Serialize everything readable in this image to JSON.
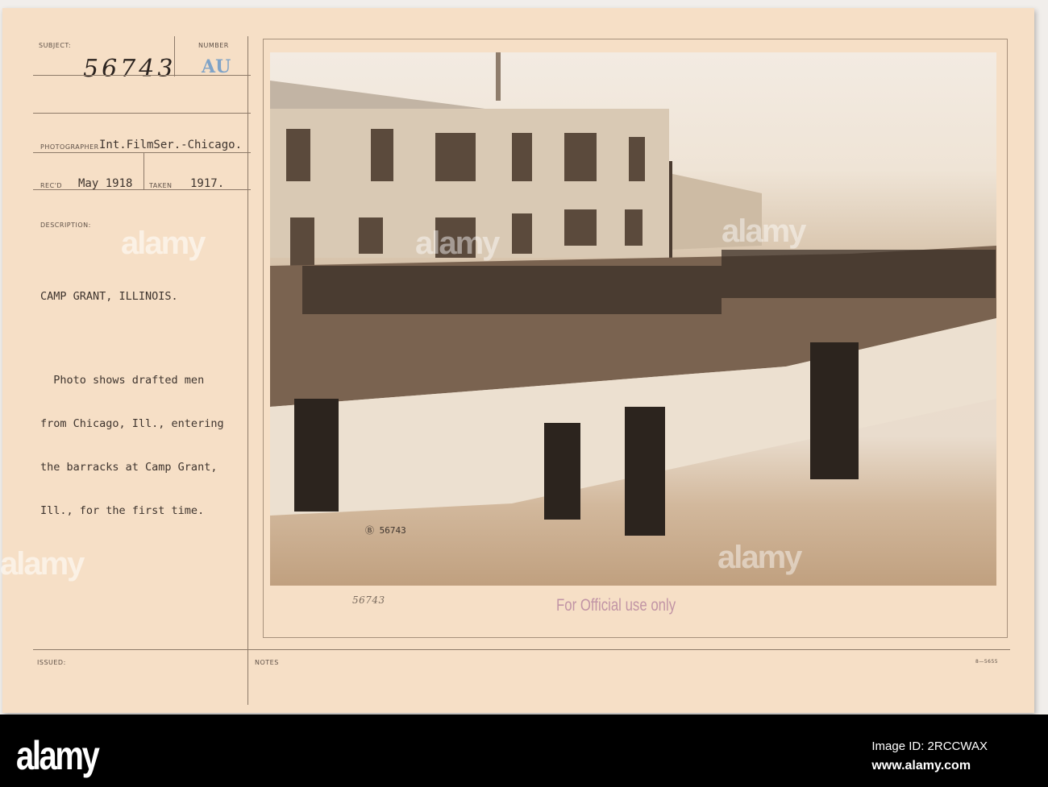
{
  "card": {
    "subject_label": "SUBJECT:",
    "subject_number": "56743",
    "number_label": "NUMBER",
    "number_value": "AU",
    "photographer_label": "PHOTOGRAPHER",
    "photographer_value": "Int.FilmSer.-Chicago.",
    "recd_label": "REC'D",
    "recd_value": "May 1918",
    "taken_label": "TAKEN",
    "taken_value": "1917.",
    "description_label": "DESCRIPTION:",
    "description_lines": [
      "CAMP GRANT, ILLINOIS.",
      "",
      "  Photo shows drafted men",
      "from Chicago, Ill., entering",
      "the barracks at Camp Grant,",
      "Ill., for the first time."
    ],
    "issued_label": "ISSUED:",
    "notes_label": "NOTES",
    "form_code": "8—5655"
  },
  "photo": {
    "negative_number": "Ⓑ 56743",
    "handwritten_number": "56743",
    "stamp": "For Official use only",
    "stamp_color": "#b07c9a"
  },
  "banner": {
    "logo": "alamy",
    "image_id": "Image ID: 2RCCWAX",
    "url": "www.alamy.com"
  }
}
